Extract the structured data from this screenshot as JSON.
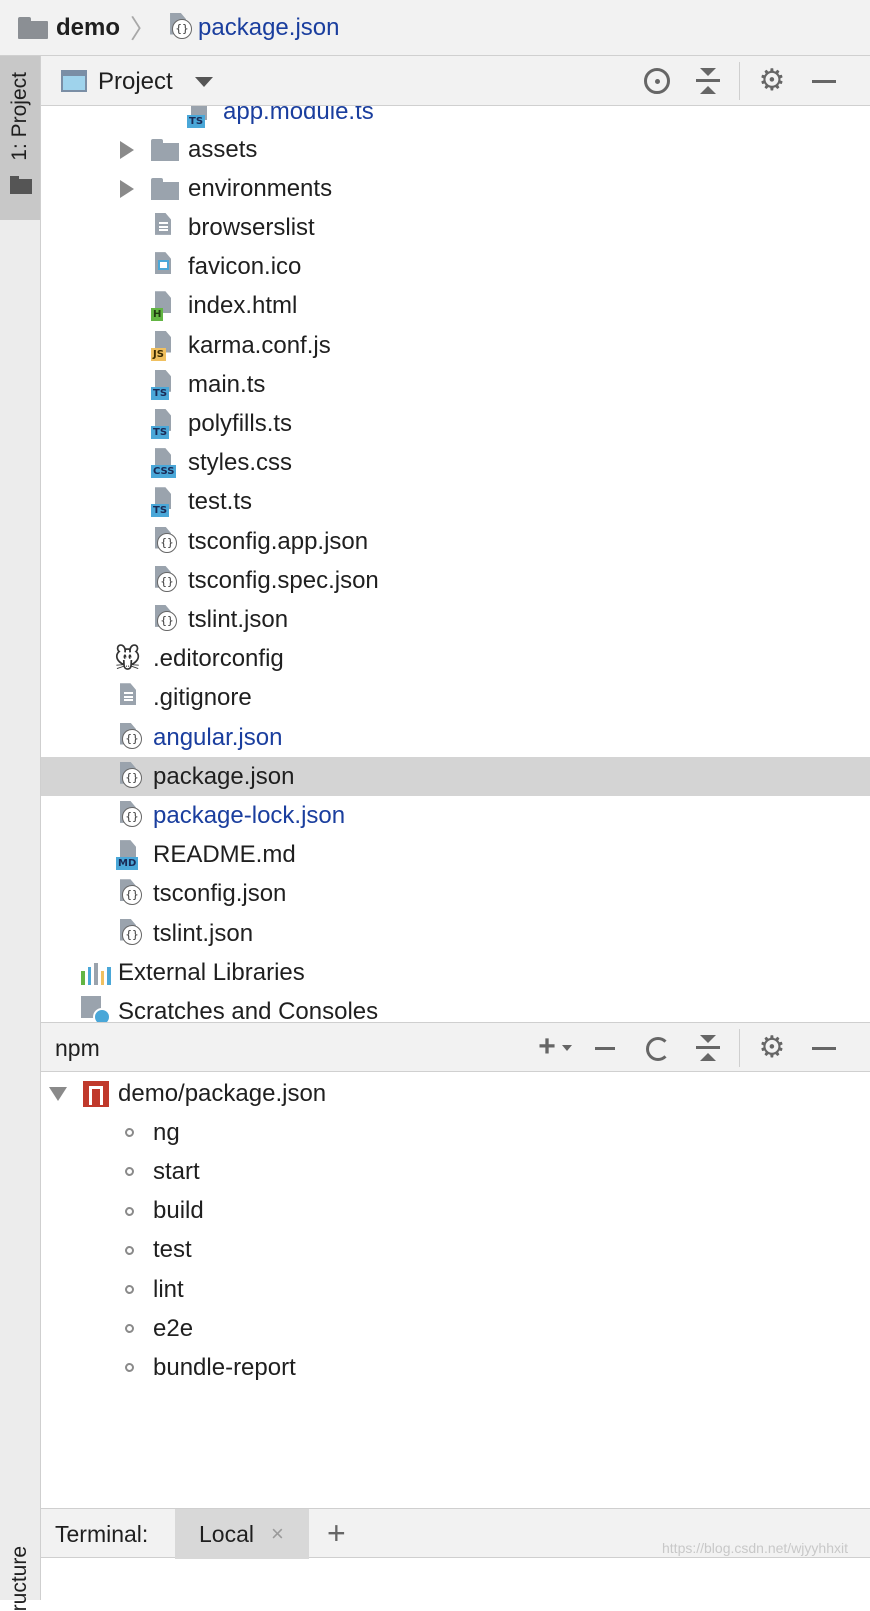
{
  "breadcrumb": {
    "project": "demo",
    "file": "package.json"
  },
  "left_stripe": {
    "project_tab": "1: Project",
    "structure_tab": "ructure"
  },
  "project_panel": {
    "title": "Project",
    "partial_top_item": "app.module.ts",
    "tree": [
      {
        "label": "assets",
        "icon": "folder-icon",
        "expandable": true,
        "vcs": false
      },
      {
        "label": "environments",
        "icon": "folder-icon",
        "expandable": true,
        "vcs": false
      },
      {
        "label": "browserslist",
        "icon": "text-file-icon",
        "expandable": false,
        "vcs": false
      },
      {
        "label": "favicon.ico",
        "icon": "image-file-icon",
        "expandable": false,
        "vcs": false
      },
      {
        "label": "index.html",
        "icon": "html-file-icon",
        "tag": "H",
        "expandable": false,
        "vcs": false
      },
      {
        "label": "karma.conf.js",
        "icon": "js-file-icon",
        "tag": "JS",
        "expandable": false,
        "vcs": false
      },
      {
        "label": "main.ts",
        "icon": "ts-file-icon",
        "tag": "TS",
        "expandable": false,
        "vcs": false
      },
      {
        "label": "polyfills.ts",
        "icon": "ts-file-icon",
        "tag": "TS",
        "expandable": false,
        "vcs": false
      },
      {
        "label": "styles.css",
        "icon": "css-file-icon",
        "tag": "CSS",
        "expandable": false,
        "vcs": false
      },
      {
        "label": "test.ts",
        "icon": "ts-file-icon",
        "tag": "TS",
        "expandable": false,
        "vcs": false
      },
      {
        "label": "tsconfig.app.json",
        "icon": "json-file-icon",
        "expandable": false,
        "vcs": false
      },
      {
        "label": "tsconfig.spec.json",
        "icon": "json-file-icon",
        "expandable": false,
        "vcs": false
      },
      {
        "label": "tslint.json",
        "icon": "json-file-icon",
        "expandable": false,
        "vcs": false
      },
      {
        "label": ".editorconfig",
        "icon": "editorconfig-icon",
        "expandable": false,
        "vcs": false
      },
      {
        "label": ".gitignore",
        "icon": "text-file-icon",
        "expandable": false,
        "vcs": false
      },
      {
        "label": "angular.json",
        "icon": "json-file-icon",
        "expandable": false,
        "vcs": true
      },
      {
        "label": "package.json",
        "icon": "json-file-icon",
        "expandable": false,
        "vcs": false,
        "selected": true
      },
      {
        "label": "package-lock.json",
        "icon": "json-file-icon",
        "expandable": false,
        "vcs": true
      },
      {
        "label": "README.md",
        "icon": "markdown-file-icon",
        "tag": "MD",
        "expandable": false,
        "vcs": false
      },
      {
        "label": "tsconfig.json",
        "icon": "json-file-icon",
        "expandable": false,
        "vcs": false
      },
      {
        "label": "tslint.json",
        "icon": "json-file-icon",
        "expandable": false,
        "vcs": false
      },
      {
        "label": "External Libraries",
        "icon": "external-libraries-icon",
        "expandable": false,
        "vcs": false
      },
      {
        "label": "Scratches and Consoles",
        "icon": "scratches-icon",
        "expandable": false,
        "vcs": false
      }
    ]
  },
  "npm_panel": {
    "title": "npm",
    "root": "demo/package.json",
    "scripts": [
      "ng",
      "start",
      "build",
      "test",
      "lint",
      "e2e",
      "bundle-report"
    ]
  },
  "terminal": {
    "label": "Terminal:",
    "tab": "Local",
    "close_glyph": "×",
    "add_glyph": "+"
  },
  "watermark": "https://blog.csdn.net/wjyyhhxit",
  "colors": {
    "vcs_link": "#1a3e9e",
    "selection": "#d4d4d4",
    "header_bg": "#f2f2f2",
    "npm_logo": "#c0392b"
  }
}
